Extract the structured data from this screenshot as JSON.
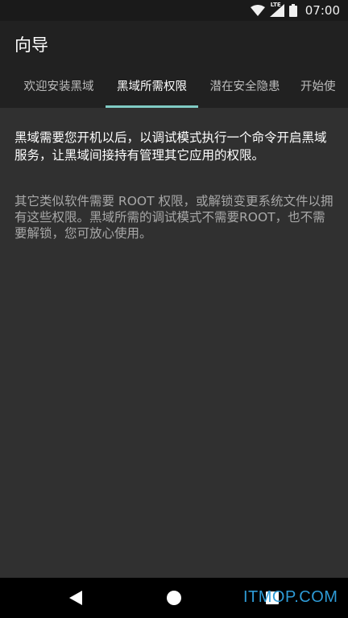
{
  "status_bar": {
    "time": "07:00",
    "network_label": "LTE",
    "icons": [
      "wifi-icon",
      "signal-icon",
      "battery-icon"
    ]
  },
  "app_bar": {
    "title": "向导"
  },
  "tabs": [
    {
      "label": "欢迎安装黑域",
      "active": false
    },
    {
      "label": "黑域所需权限",
      "active": true
    },
    {
      "label": "潜在安全隐患",
      "active": false
    },
    {
      "label": "开始使",
      "active": false
    }
  ],
  "content": {
    "paragraph_1": "黑域需要您开机以后，以调试模式执行一个命令开启黑域服务，让黑域间接持有管理其它应用的权限。",
    "paragraph_2": "其它类似软件需要 ROOT 权限，或解锁变更系统文件以拥有这些权限。黑域所需的调试模式不需要ROOT，也不需要解锁，您可放心使用。"
  },
  "nav_bar": {
    "icons": [
      "back-icon",
      "home-icon",
      "recent-apps-icon"
    ]
  },
  "watermark": "ITMOP.COM",
  "colors": {
    "background": "#303030",
    "app_bar": "#212121",
    "tab_indicator": "#80cbc4",
    "secondary_text": "#a8a8a8"
  }
}
